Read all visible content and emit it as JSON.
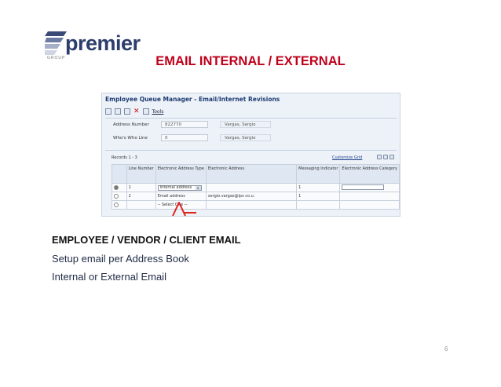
{
  "slide": {
    "logo_text": "premier",
    "logo_subtext": "GROUP",
    "title": "EMAIL INTERNAL / EXTERNAL",
    "heading": "EMPLOYEE / VENDOR / CLIENT EMAIL",
    "line1": "Setup email per Address Book",
    "line2": "Internal or External Email",
    "page_number": "6",
    "colors": {
      "title": "#c0001b",
      "logo": "#2d3e6e",
      "arrow": "#e0241b"
    }
  },
  "screenshot": {
    "window_title": "Employee Queue Manager - Email/Internet Revisions",
    "toolbar": {
      "tools_label": "Tools",
      "icons": [
        "save-icon",
        "copy-icon",
        "delete-icon",
        "close-icon"
      ]
    },
    "fields": {
      "address_number_label": "Address Number",
      "address_number_value": "822770",
      "address_number_name": "Vargas, Sergio",
      "whos_who_label": "Who's Who Line",
      "whos_who_value": "0",
      "whos_who_name": "Vargas, Sergio"
    },
    "grid": {
      "records_label": "Records 1 - 3",
      "customize_label": "Customize Grid",
      "columns": [
        "",
        "Line Number",
        "Electronic Address Type",
        "Electronic Address",
        "Messaging Indicator",
        "Electronic Address Category"
      ],
      "rows": [
        {
          "selected": true,
          "line": "1",
          "type": "Internal address",
          "address": "",
          "indicator": "1",
          "category": ""
        },
        {
          "selected": false,
          "line": "2",
          "type": "Email address",
          "address": "sergio.vargas@ips  co.u.",
          "indicator": "1",
          "category": ""
        },
        {
          "selected": false,
          "line": "",
          "type": "-- Select One --",
          "address": "",
          "indicator": "",
          "category": ""
        }
      ]
    }
  }
}
